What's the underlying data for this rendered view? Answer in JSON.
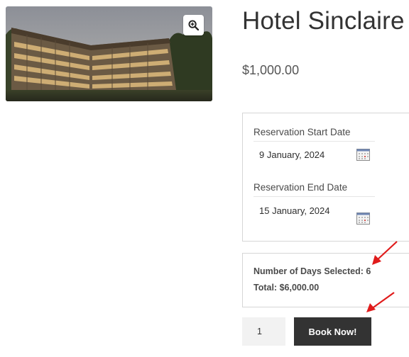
{
  "product": {
    "image_alt": "Hotel building photo",
    "zoom_icon": "magnifier-plus-icon",
    "title": "Hotel Sinclaire",
    "price": "$1,000.00"
  },
  "reservation": {
    "start_label": "Reservation Start Date",
    "start_value": "9 January, 2024",
    "end_label": "Reservation End Date",
    "end_value": "15 January, 2024",
    "calendar_icon": "calendar-icon"
  },
  "summary": {
    "days_text": "Number of Days Selected: 6",
    "total_text": "Total: $6,000.00"
  },
  "cart": {
    "quantity": "1",
    "book_label": "Book Now!"
  },
  "annotation": {
    "arrow_color": "#e01b1b",
    "arrow_icon": "red-arrow-icon"
  },
  "colors": {
    "button_bg": "#333333",
    "box_border": "#d6d6d6",
    "qty_bg": "#f2f2f2"
  }
}
